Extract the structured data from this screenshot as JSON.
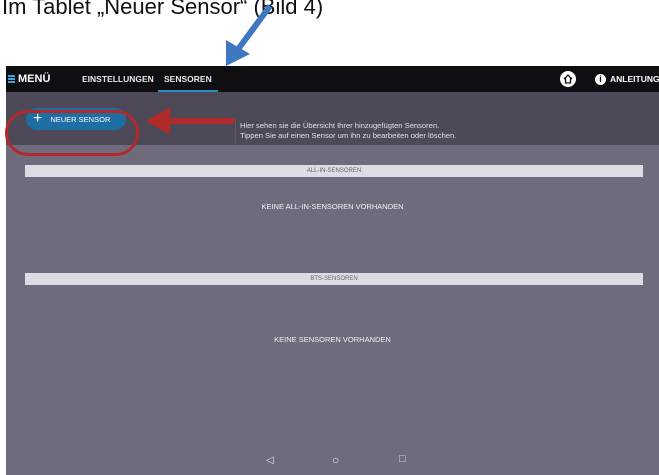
{
  "caption": "Im Tablet „Neuer Sensor“ (Bild 4)",
  "topbar": {
    "menu_label": "MENÜ",
    "tabs": [
      {
        "label": "EINSTELLUNGEN",
        "active": false
      },
      {
        "label": "SENSOREN",
        "active": true
      }
    ],
    "info_label": "ANLEITUNG"
  },
  "toolbar": {
    "new_sensor_label": "NEUER SENSOR",
    "hint_line1": "Hier sehen sie die Übersicht Ihrer hinzugefügten Sensoren.",
    "hint_line2": "Tippen Sie auf einen Sensor um ihn zu bearbeiten oder löschen."
  },
  "sections": [
    {
      "header": "ALL-IN-SENSOREN",
      "empty_text": "KEINE ALL-IN-SENSOREN VORHANDEN"
    },
    {
      "header": "BTS-SENSOREN",
      "empty_text": "KEINE SENSOREN VORHANDEN"
    }
  ],
  "navbar": {
    "back": "◁",
    "home": "○",
    "recent": "□"
  },
  "colors": {
    "accent": "#1f6ea3",
    "annotation_red": "#b02a2a",
    "annotation_blue": "#3f78c0"
  }
}
